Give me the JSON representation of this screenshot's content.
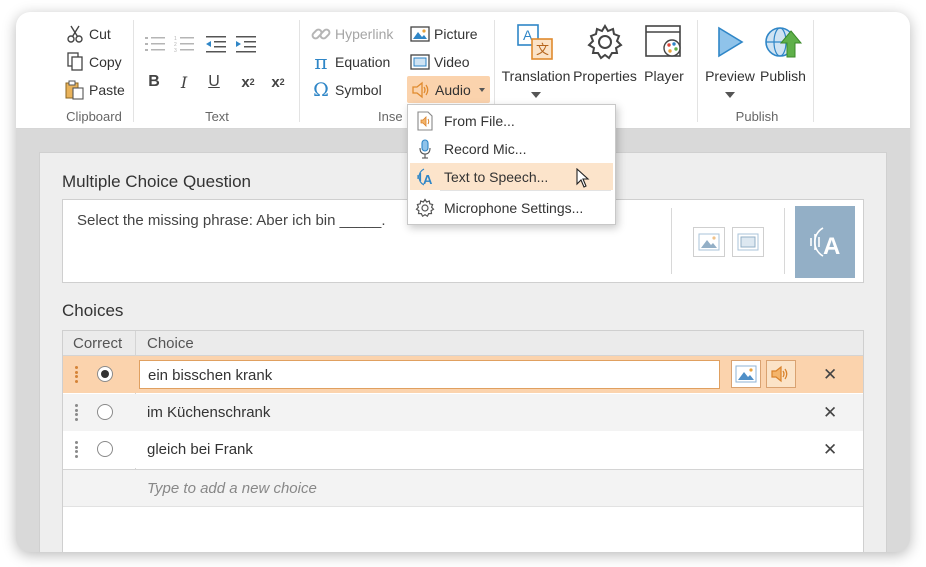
{
  "colors": {
    "accent": "#fbd3ad",
    "accent_highlight": "#fce4cb",
    "tts_tile": "#93afc6",
    "icon_blue": "#2f86c7"
  },
  "ribbon": {
    "clipboard": {
      "cut": "Cut",
      "copy": "Copy",
      "paste": "Paste",
      "group_label": "Clipboard"
    },
    "text": {
      "group_label": "Text"
    },
    "insert": {
      "hyperlink": "Hyperlink",
      "equation": "Equation",
      "symbol": "Symbol",
      "picture": "Picture",
      "video": "Video",
      "audio": "Audio",
      "group_label": "Inse"
    },
    "tools": {
      "translation": "Translation",
      "properties": "Properties",
      "player": "Player"
    },
    "publish": {
      "preview": "Preview",
      "publish": "Publish",
      "group_label": "Publish"
    }
  },
  "audio_menu": {
    "items": [
      {
        "label": "From File...",
        "icon": "audio-file-icon"
      },
      {
        "label": "Record Mic...",
        "icon": "microphone-icon"
      },
      {
        "label": "Text to Speech...",
        "icon": "text-to-speech-icon",
        "highlighted": true
      },
      {
        "label": "Microphone Settings...",
        "icon": "gear-icon"
      }
    ]
  },
  "question": {
    "title": "Multiple Choice Question",
    "text": "Select the missing phrase: Aber ich bin _____."
  },
  "choices": {
    "title": "Choices",
    "header_correct": "Correct",
    "header_choice": "Choice",
    "rows": [
      {
        "text": "ein bisschen krank",
        "correct": true,
        "selected": true
      },
      {
        "text": "im Küchenschrank",
        "correct": false,
        "selected": false
      },
      {
        "text": "gleich bei Frank",
        "correct": false,
        "selected": false
      }
    ],
    "new_placeholder": "Type to add a new choice"
  }
}
